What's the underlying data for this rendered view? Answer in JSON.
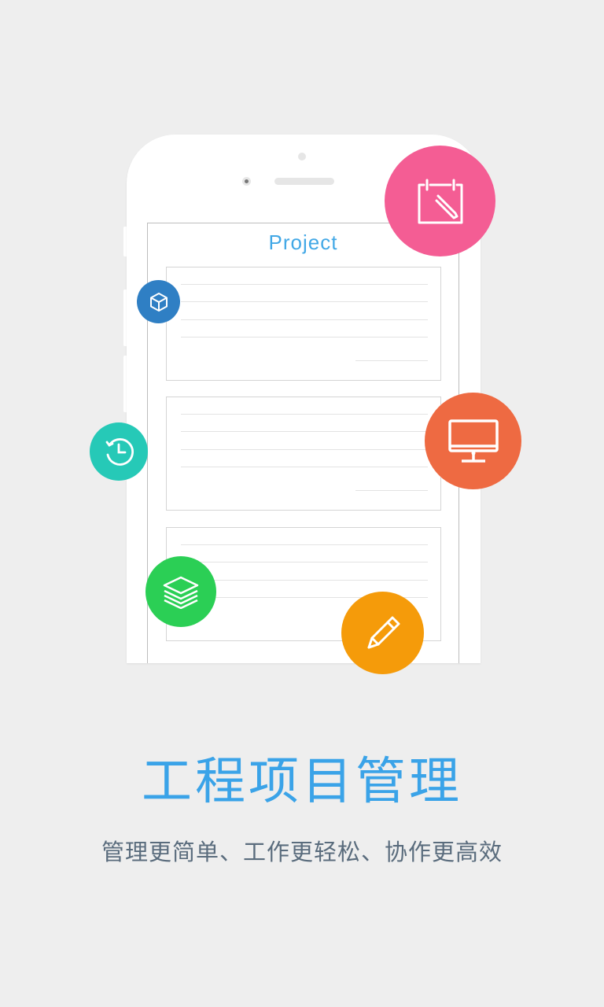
{
  "mockup": {
    "screen_title": "Project",
    "cards": 3
  },
  "badges": {
    "calendar": {
      "icon": "calendar-edit-icon",
      "color": "#f45d94"
    },
    "cube": {
      "icon": "cube-icon",
      "color": "#2f7fc4"
    },
    "monitor": {
      "icon": "monitor-icon",
      "color": "#ee6a42"
    },
    "clock": {
      "icon": "clock-icon",
      "color": "#26c9b7"
    },
    "layers": {
      "icon": "layers-icon",
      "color": "#2bcf55"
    },
    "pencil": {
      "icon": "pencil-icon",
      "color": "#f59b0a"
    }
  },
  "headline": "工程项目管理",
  "subline": "管理更简单、工作更轻松、协作更高效",
  "colors": {
    "background": "#eeeeee",
    "headline": "#3aa3e8",
    "subline": "#5a6c7d",
    "screen_title": "#42a8e6"
  }
}
